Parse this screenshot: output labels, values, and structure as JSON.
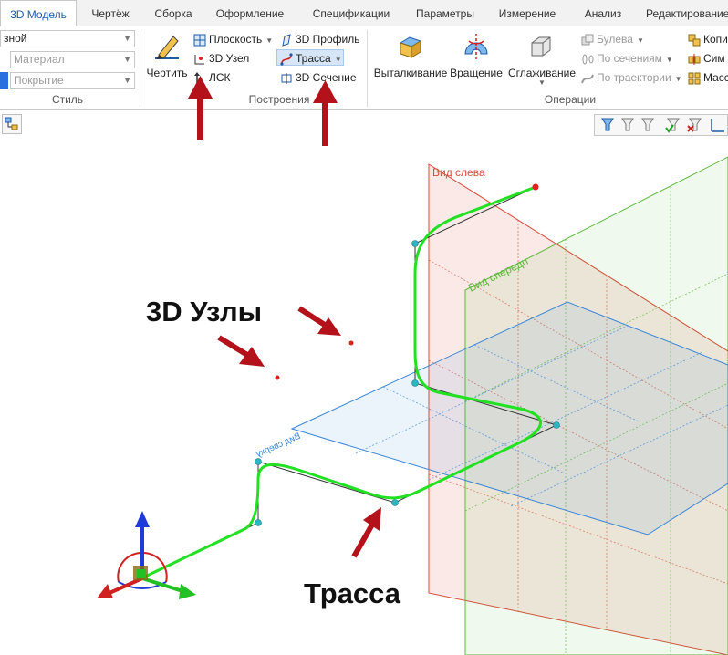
{
  "tabs": [
    {
      "label": "3D Модель",
      "active": true
    },
    {
      "label": "Чертёж"
    },
    {
      "label": "Сборка"
    },
    {
      "label": "Оформление"
    },
    {
      "label": "Спецификации"
    },
    {
      "label": "Параметры"
    },
    {
      "label": "Измерение"
    },
    {
      "label": "Анализ"
    },
    {
      "label": "Редактирование"
    }
  ],
  "style_group": {
    "title": "Стиль",
    "combo1": "зной",
    "material": "Материал",
    "coating": "Покрытие"
  },
  "constructions": {
    "title": "Построения",
    "draw": "Чертить",
    "plane": "Плоскость",
    "node": "3D Узел",
    "lsk": "ЛСК",
    "profile": "3D Профиль",
    "trace": "Трасса",
    "section": "3D Сечение"
  },
  "operations": {
    "title": "Операции",
    "extrude": "Выталкивание",
    "rotate": "Вращение",
    "smooth": "Сглаживание",
    "boolean": "Булева",
    "by_sections": "По сечениям",
    "by_trajectory": "По траектории",
    "copy": "Копи",
    "symmetry": "Сим",
    "mass": "Масс"
  },
  "planes": {
    "left": "Вид слева",
    "front": "Вид спереди",
    "top": "Вид сверху"
  },
  "annotations": {
    "nodes": "3D Узлы",
    "trace": "Трасса"
  },
  "colors": {
    "accent": "#1e5aa8",
    "trace": "#22e022",
    "arrow": "#b3121a",
    "node": "#2ab7c4",
    "point": "#e02020",
    "left_plane": "#d84c3a",
    "front_plane": "#5cb83a",
    "top_plane": "#3a86d8"
  }
}
